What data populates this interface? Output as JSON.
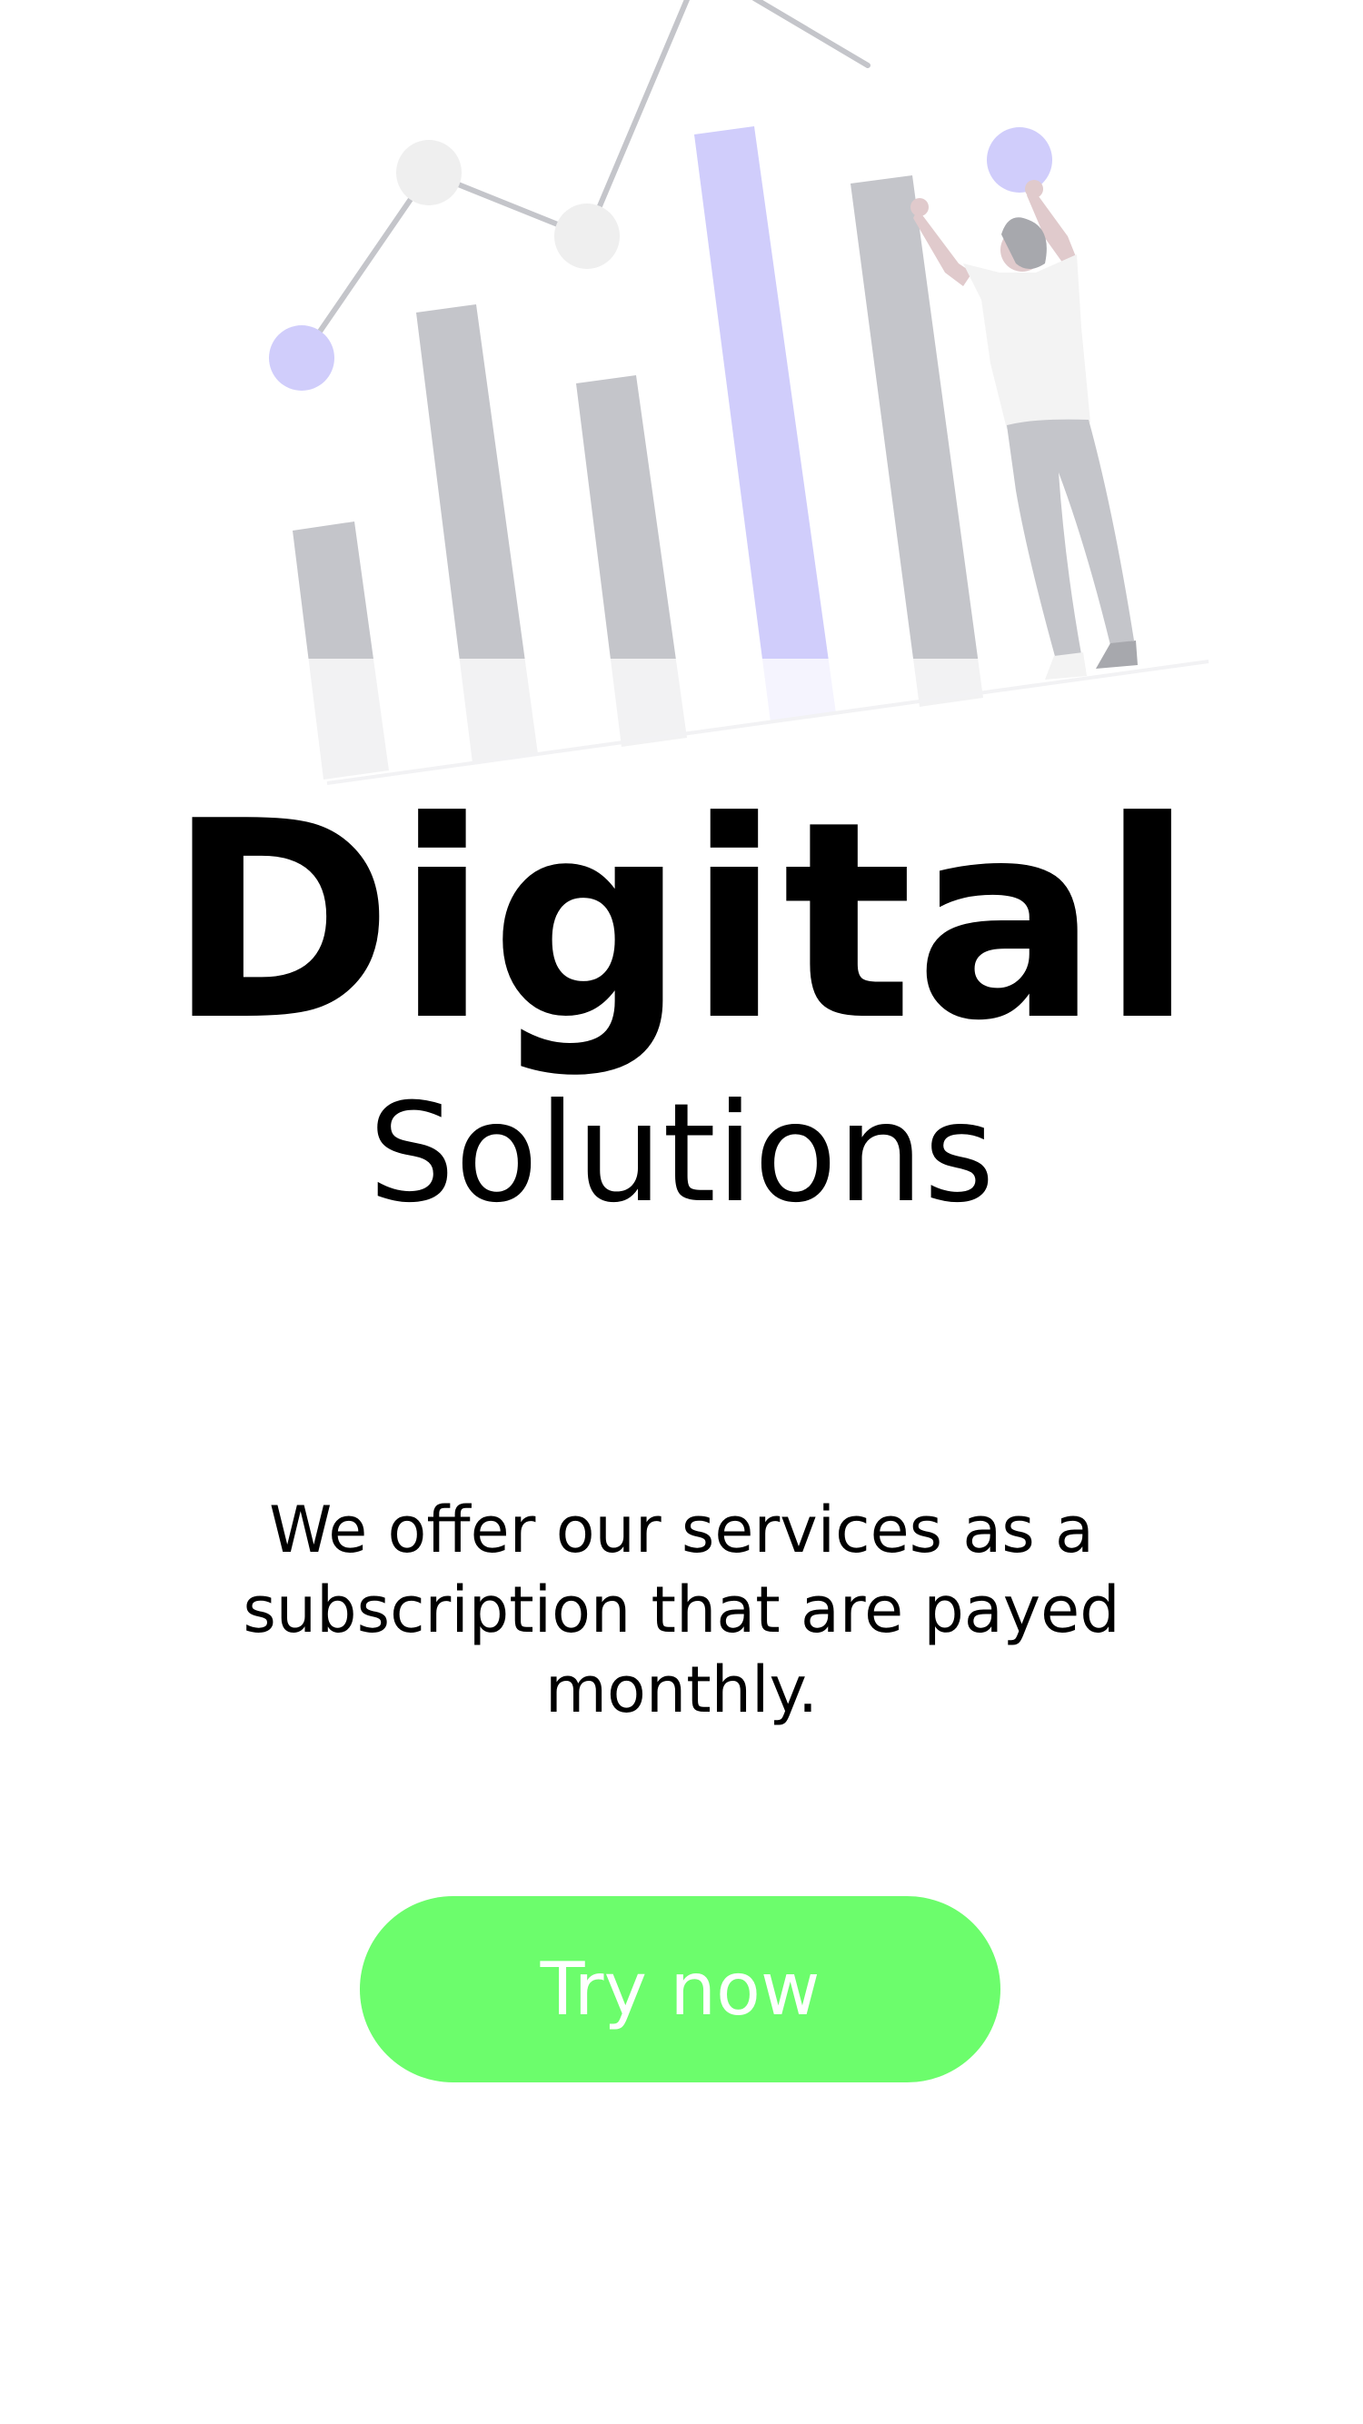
{
  "hero": {
    "illustration": "bar-chart-with-person-illustration"
  },
  "content": {
    "title": "Digital",
    "subtitle": "Solutions",
    "description": "We offer our services as a subscription that are payed monthly."
  },
  "cta": {
    "label": "Try now"
  },
  "colors": {
    "accent": "#6cfd6c",
    "bar_gray": "#c4c5ca",
    "bar_purple": "#d0cdfb",
    "background": "#ffffff",
    "text": "#000000"
  }
}
